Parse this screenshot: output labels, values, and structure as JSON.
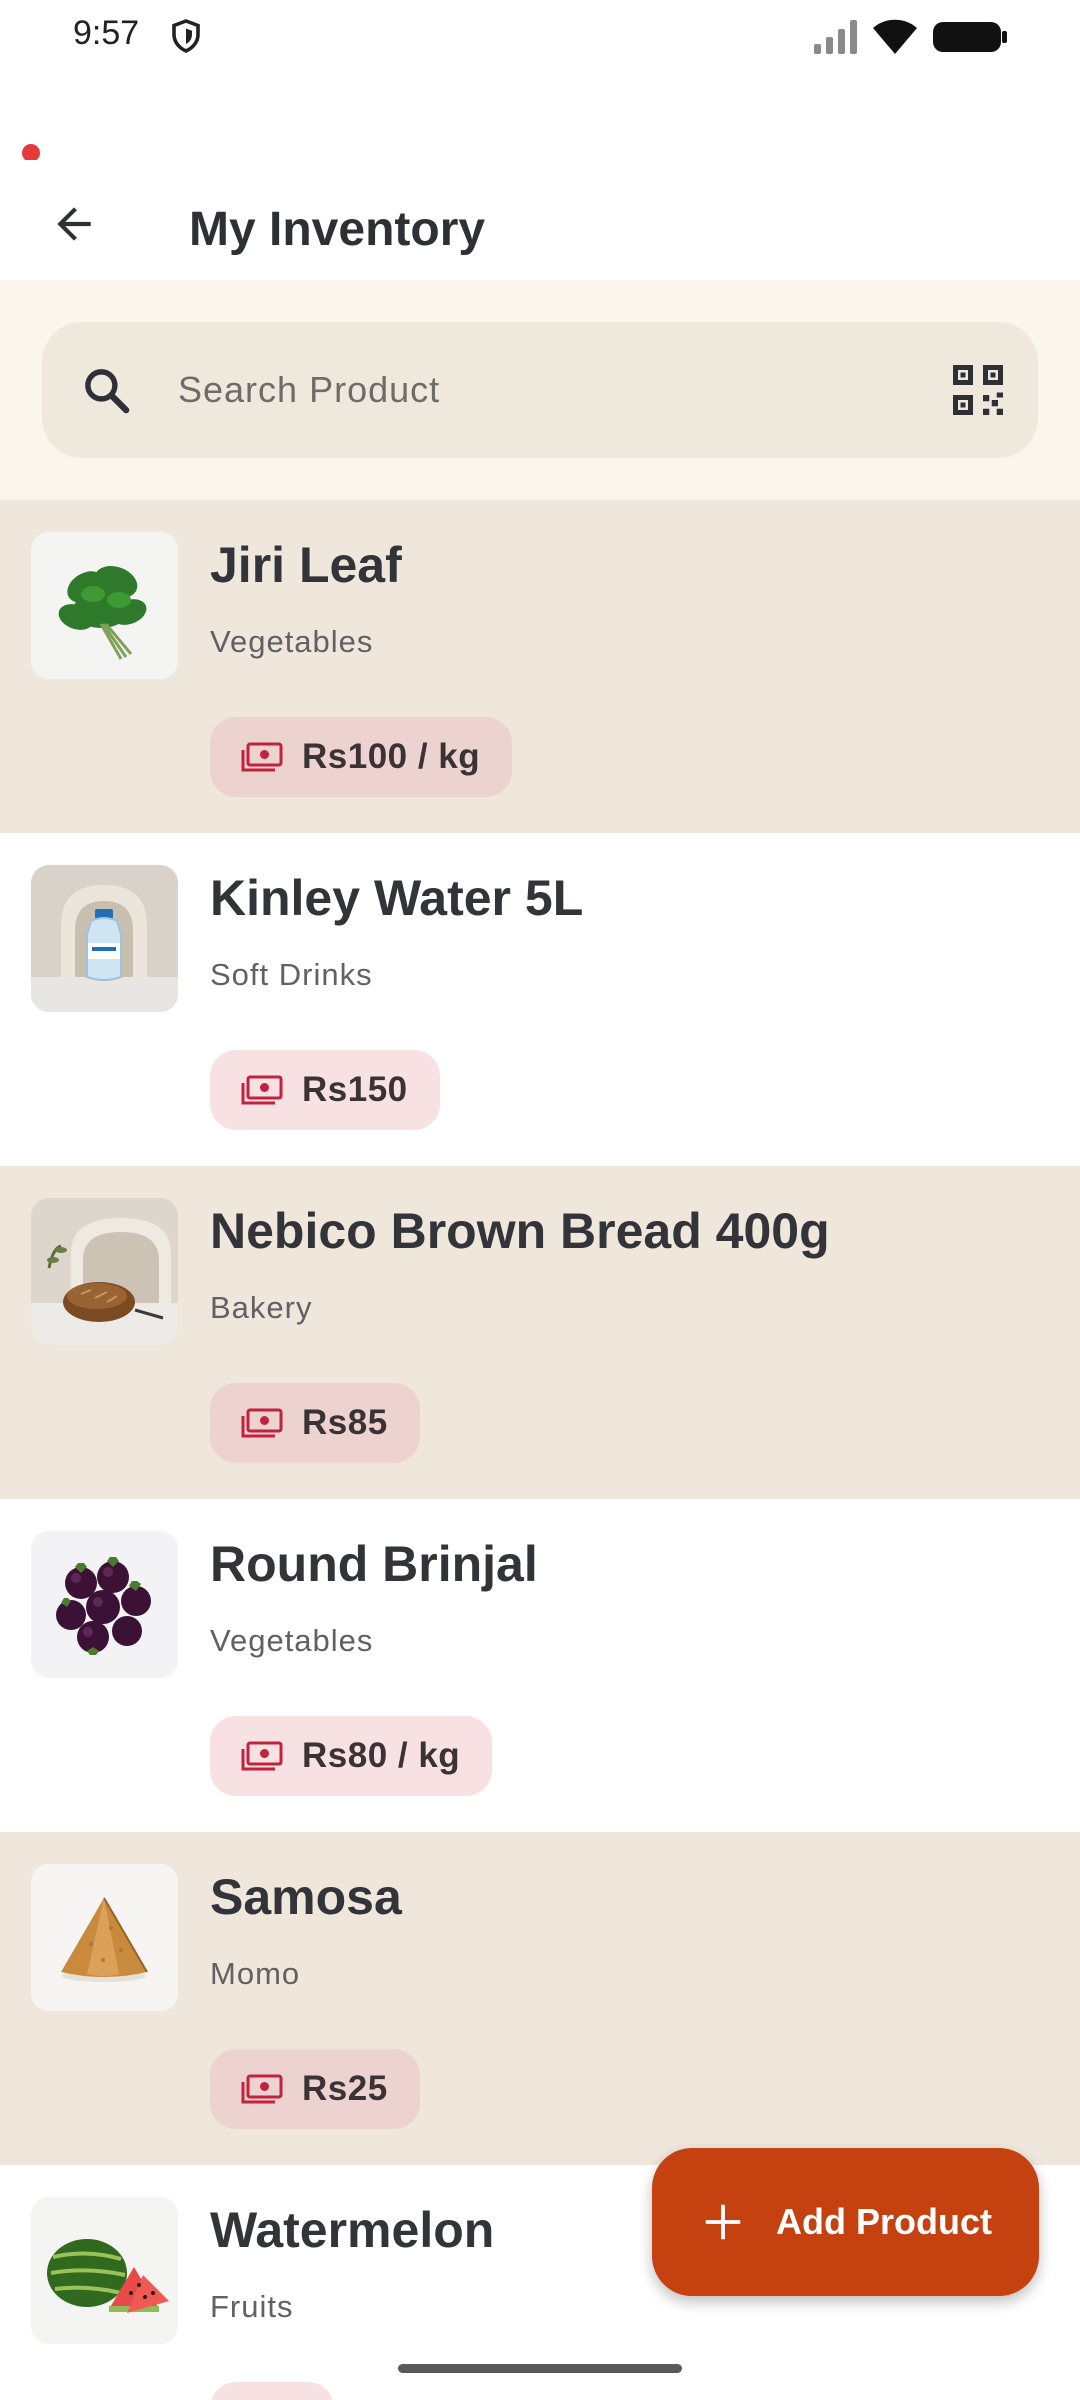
{
  "status_bar": {
    "time": "9:57",
    "icons": [
      "shield-icon",
      "signal-icon",
      "wifi-icon",
      "battery-icon"
    ]
  },
  "app_bar": {
    "title": "My Inventory",
    "back_icon": "arrow-left-icon"
  },
  "search": {
    "placeholder": "Search Product",
    "value": "",
    "left_icon": "search-icon",
    "right_icon": "qr-scan-icon"
  },
  "products": [
    {
      "name": "Jiri Leaf",
      "category": "Vegetables",
      "price": "Rs100 / kg",
      "image": "leafy-greens"
    },
    {
      "name": "Kinley Water 5L",
      "category": "Soft Drinks",
      "price": "Rs150",
      "image": "water-bottle"
    },
    {
      "name": "Nebico Brown Bread 400g",
      "category": "Bakery",
      "price": "Rs85",
      "image": "bread-loaf"
    },
    {
      "name": "Round Brinjal",
      "category": "Vegetables",
      "price": "Rs80 / kg",
      "image": "brinjals"
    },
    {
      "name": "Samosa",
      "category": "Momo",
      "price": "Rs25",
      "image": "samosa"
    },
    {
      "name": "Watermelon",
      "category": "Fruits",
      "price": "",
      "image": "watermelon"
    }
  ],
  "fab": {
    "label": "Add Product",
    "icon": "plus-icon"
  },
  "colors": {
    "accent": "#c5410f",
    "row_shaded": "#efe7dc",
    "row_plain": "#ffffff",
    "search_bg": "#efe8dd",
    "price_icon": "#c2223e"
  }
}
